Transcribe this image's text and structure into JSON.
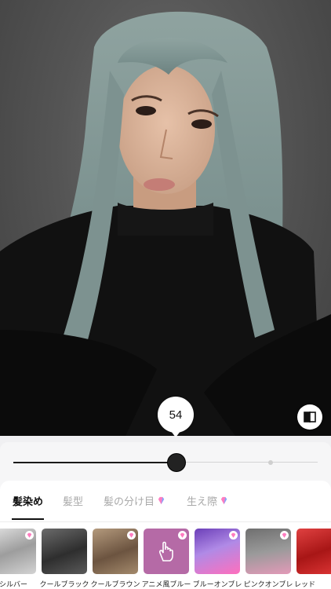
{
  "editor": {
    "slider_value": "54",
    "slider_fraction": 0.54,
    "compare_icon": "compare-split-icon"
  },
  "tabs": [
    {
      "label": "髪染め",
      "premium": false,
      "active": true
    },
    {
      "label": "髪型",
      "premium": false,
      "active": false
    },
    {
      "label": "髪の分け目",
      "premium": true,
      "active": false
    },
    {
      "label": "生え際",
      "premium": true,
      "active": false
    }
  ],
  "colors": [
    {
      "label": "シルバー",
      "color": "#bfbfbf",
      "premium": false
    },
    {
      "label": "クールブラック",
      "color": "#4a4a4a",
      "premium": false
    },
    {
      "label": "クールブラウン",
      "color": "#8c7358",
      "premium": true
    },
    {
      "label": "アニメ風ブルー",
      "color": "#b56aa6",
      "premium": true,
      "icon": "hand-icon"
    },
    {
      "label": "ブルーオンブレ",
      "color": "#8a5cc9",
      "premium": true
    },
    {
      "label": "ピンクオンブレ",
      "color": "#9a8a8a",
      "premium": true
    },
    {
      "label": "レッド",
      "color": "#c32626",
      "premium": false
    }
  ],
  "accent": "#111111",
  "premium_gem_colors": [
    "#ff7dc0",
    "#7fa6ff"
  ]
}
